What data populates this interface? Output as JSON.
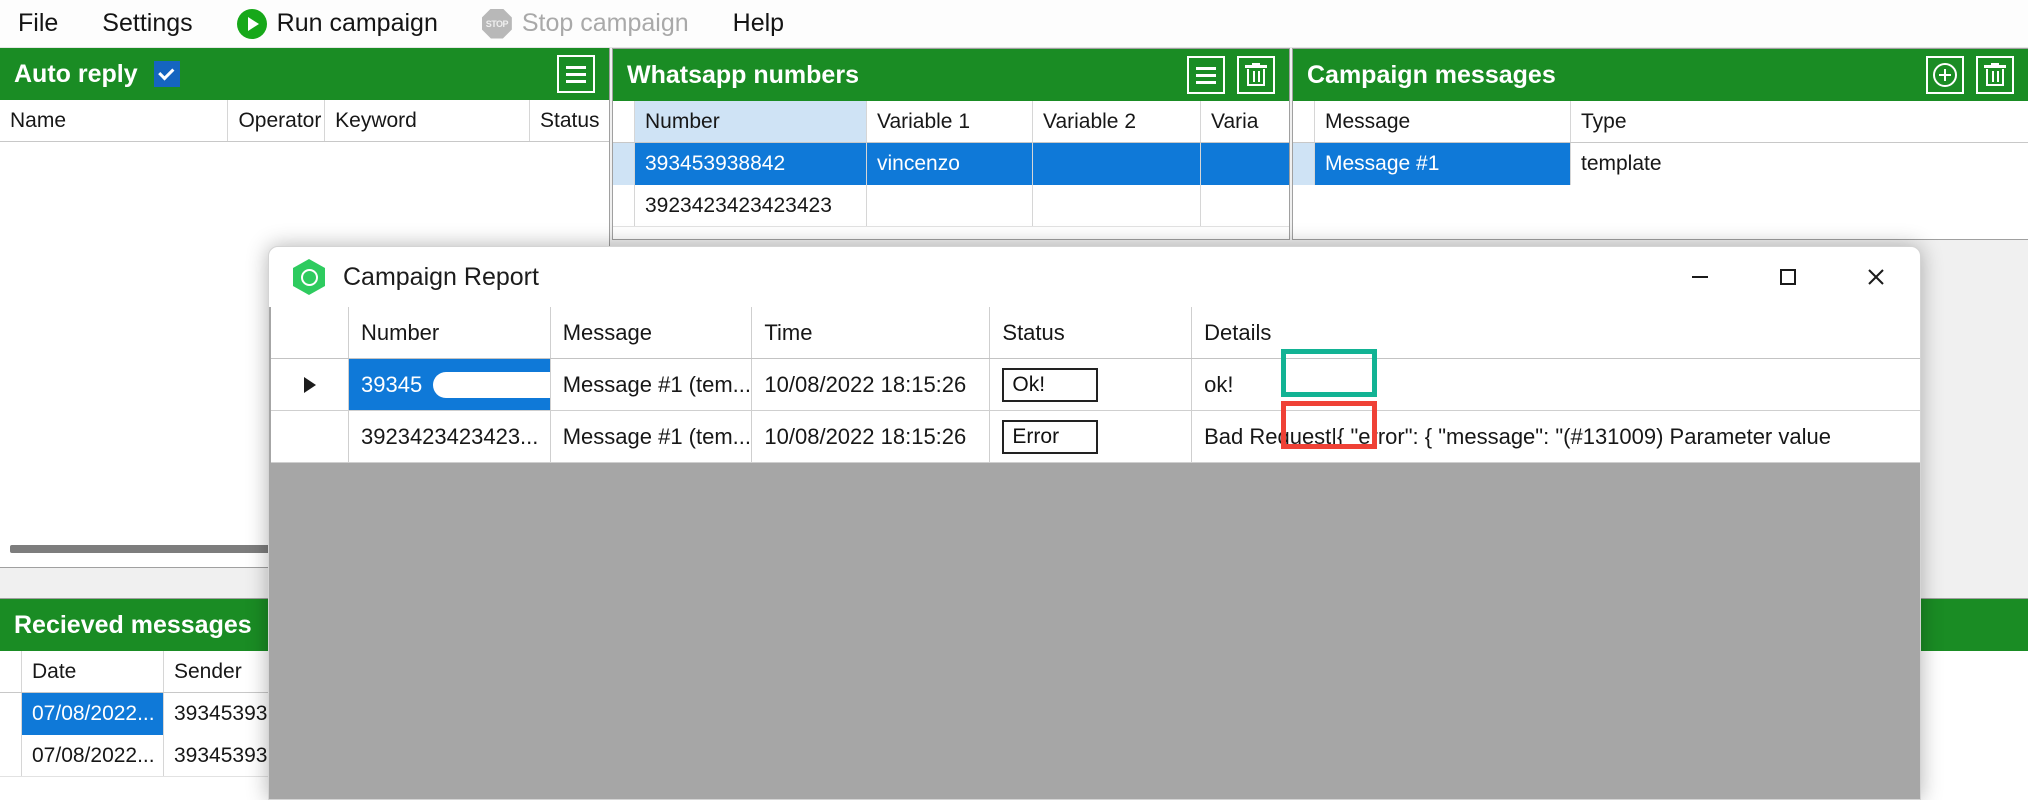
{
  "menubar": {
    "items": [
      {
        "label": "File",
        "icon": null,
        "disabled": false
      },
      {
        "label": "Settings",
        "icon": null,
        "disabled": false
      },
      {
        "label": "Run campaign",
        "icon": "play-circle-icon",
        "disabled": false
      },
      {
        "label": "Stop campaign",
        "icon": "stop-sign-icon",
        "disabled": true
      },
      {
        "label": "Help",
        "icon": null,
        "disabled": false
      }
    ]
  },
  "colors": {
    "panel_header_green": "#1a8c24",
    "selection_blue": "#0f79d8",
    "header_select_blue": "#cfe3f5",
    "ok_highlight": "#12b394",
    "error_highlight": "#ef4136",
    "dialog_body_gray": "#a6a6a6",
    "run_icon_green": "#17a81a"
  },
  "panels": {
    "auto_reply": {
      "title": "Auto reply",
      "checkbox_checked": true,
      "menu_icon": "hamburger-menu-icon",
      "columns": [
        "Name",
        "Operator",
        "Keyword",
        "Status"
      ],
      "rows": []
    },
    "whatsapp_numbers": {
      "title": "Whatsapp numbers",
      "menu_icon": "hamburger-menu-icon",
      "delete_icon": "trash-icon",
      "columns": [
        "Number",
        "Variable 1",
        "Variable 2",
        "Varia"
      ],
      "rows": [
        {
          "cells": [
            "393453938842",
            "vincenzo",
            "",
            ""
          ],
          "selected": true
        },
        {
          "cells": [
            "3923423423423423",
            "",
            "",
            ""
          ],
          "selected": false
        }
      ]
    },
    "campaign_messages": {
      "title": "Campaign messages",
      "add_icon": "plus-circle-icon",
      "delete_icon": "trash-icon",
      "columns": [
        "Message",
        "Type"
      ],
      "rows": [
        {
          "cells": [
            "Message #1",
            "template"
          ],
          "selected": true
        }
      ]
    },
    "recieved_messages": {
      "title": "Recieved messages",
      "columns": [
        "Date",
        "Sender"
      ],
      "rows": [
        {
          "cells": [
            "07/08/2022...",
            "39345393"
          ],
          "selected": true
        },
        {
          "cells": [
            "07/08/2022...",
            "39345393"
          ],
          "selected": false
        }
      ]
    }
  },
  "dialog": {
    "title": "Campaign Report",
    "app_icon": "whatsapp-hexagon-icon",
    "window_controls": {
      "minimize": "minimize-icon",
      "maximize": "maximize-icon",
      "close": "close-icon"
    },
    "columns": [
      "Number",
      "Message",
      "Time",
      "Status",
      "Details"
    ],
    "rows": [
      {
        "number": "39345",
        "number_redacted": true,
        "message": "Message #1 (tem...",
        "time": "10/08/2022 18:15:26",
        "status": "Ok!",
        "status_highlight": "ok",
        "details": "ok!",
        "selected": true,
        "row_indicator": true
      },
      {
        "number": "3923423423423...",
        "number_redacted": false,
        "message": "Message #1 (tem...",
        "time": "10/08/2022 18:15:26",
        "status": "Error",
        "status_highlight": "error",
        "details": "Bad Request|{   \"error\": {      \"message\": \"(#131009) Parameter value",
        "selected": false,
        "row_indicator": false
      }
    ]
  }
}
